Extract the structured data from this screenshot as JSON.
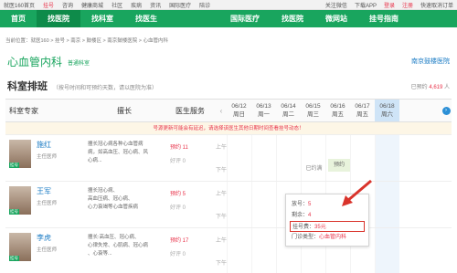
{
  "topbar": {
    "left": [
      "就医160首页",
      "挂号",
      "咨询",
      "健康商城",
      "社区",
      "疾病",
      "资讯",
      "国际医疗",
      "陪诊"
    ],
    "right": [
      "关注微信",
      "下载APP",
      "登录",
      "注册",
      "快速取消订单"
    ]
  },
  "nav": [
    "首页",
    "找医院",
    "找科室",
    "找医生",
    "国际医疗",
    "找医院",
    "微网站",
    "挂号指南"
  ],
  "breadcrumb": "当前位置：就医160 > 挂号 > 南京 > 鼓楼区 > 南京鼓楼医院 > 心血管内科",
  "dept": {
    "title": "心血管内科",
    "tag": "普通科室",
    "hospital": "南京鼓楼医院"
  },
  "schedule": {
    "title": "科室排班",
    "note": "（按号时间和可预约天数，请以医院为准）",
    "booked_prefix": "已预约 ",
    "booked_count": "4,619",
    "booked_suffix": " 人"
  },
  "headers": {
    "doctor": "科室专家",
    "specialty": "擅长",
    "service": "医生服务"
  },
  "days": [
    {
      "date": "06/12",
      "wd": "周日"
    },
    {
      "date": "06/13",
      "wd": "周一"
    },
    {
      "date": "06/14",
      "wd": "周二"
    },
    {
      "date": "06/15",
      "wd": "周三"
    },
    {
      "date": "06/16",
      "wd": "周五"
    },
    {
      "date": "06/17",
      "wd": "周五"
    },
    {
      "date": "06/18",
      "wd": "周六"
    }
  ],
  "notice": "号源更新可能会有延迟，请选择该医生其他日期时间查看挂号动态！",
  "doctors": [
    {
      "name": "施红",
      "title": "主任医师",
      "spec": [
        "擅长冠心病各种心血管病",
        "病，如高血压、冠心病、风",
        "心病..."
      ],
      "booked": "预约 11",
      "rating": "好评 0"
    },
    {
      "name": "王军",
      "title": "主任医师",
      "spec": [
        "擅长冠心病、",
        "高血压病、冠心病、",
        "心力衰竭等心血管疾病"
      ],
      "booked": "预约 5",
      "rating": "好评 0"
    },
    {
      "name": "李虎",
      "title": "主任医师",
      "spec": [
        "擅长:高血压、冠心病、",
        "心律失常、心肌病、冠心病",
        "、心衰等..."
      ],
      "booked": "预约 17",
      "rating": "好评 0"
    }
  ],
  "badge": "挂号",
  "ampm": {
    "am": "上午",
    "pm": "下午"
  },
  "slots": {
    "full": "已约满",
    "book": "预约"
  },
  "popup": {
    "count_label": "放号：",
    "count": "5",
    "left_label": "剩余：",
    "left": "4",
    "fee_label": "挂号费：",
    "fee": "35元",
    "type_label": "门诊类型：",
    "type": "心血管内科"
  },
  "colors": {
    "green": "#19a55e",
    "red": "#e8334a",
    "blue": "#1a7bc4"
  }
}
